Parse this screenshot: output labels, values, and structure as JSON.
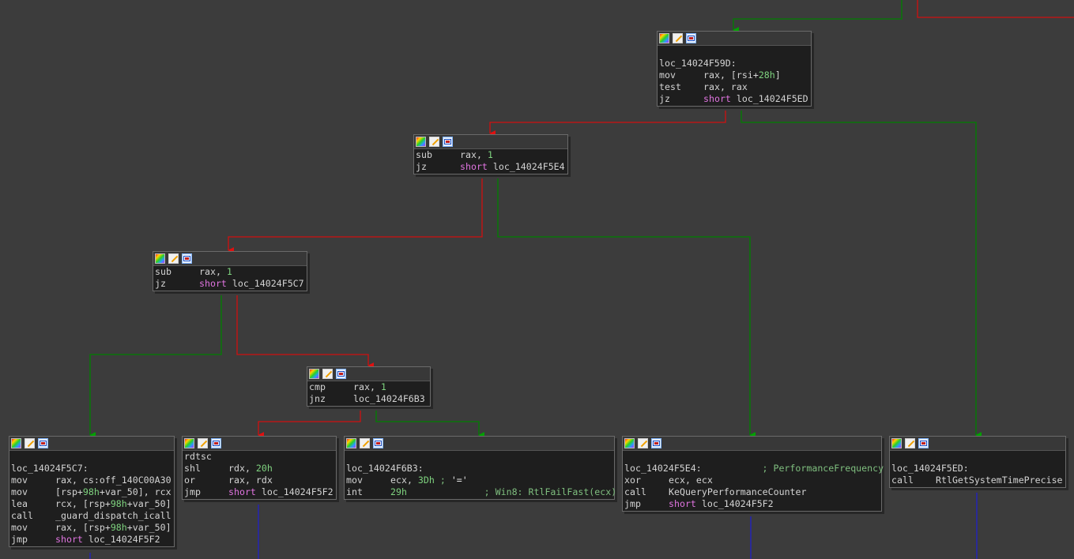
{
  "nodes": {
    "n59d": {
      "label": "loc_14024F59D:",
      "lines": [
        {
          "mn": "mov",
          "op": "rax, [rsi+",
          "num": "28h",
          "rest": "]"
        },
        {
          "mn": "test",
          "op": "rax, rax"
        },
        {
          "mn": "jz",
          "kw": "short",
          "target": "loc_14024F5ED"
        }
      ]
    },
    "n_sub1": {
      "lines": [
        {
          "mn": "sub",
          "op": "rax, ",
          "num": "1"
        },
        {
          "mn": "jz",
          "kw": "short",
          "target": "loc_14024F5E4"
        }
      ]
    },
    "n_sub2": {
      "lines": [
        {
          "mn": "sub",
          "op": "rax, ",
          "num": "1"
        },
        {
          "mn": "jz",
          "kw": "short",
          "target": "loc_14024F5C7"
        }
      ]
    },
    "n_cmp": {
      "lines": [
        {
          "mn": "cmp",
          "op": "rax, ",
          "num": "1"
        },
        {
          "mn": "jnz",
          "target": "loc_14024F6B3"
        }
      ]
    },
    "n5c7": {
      "label": "loc_14024F5C7:",
      "lines": [
        {
          "mn": "mov",
          "op": "rax, cs:off_140C00A30"
        },
        {
          "mn": "mov",
          "op": "[rsp+",
          "num": "98h",
          "rest": "+var_50], rcx"
        },
        {
          "mn": "lea",
          "op": "rcx, [rsp+",
          "num": "98h",
          "rest": "+var_50]"
        },
        {
          "mn": "call",
          "op": "_guard_dispatch_icall"
        },
        {
          "mn": "mov",
          "op": "rax, [rsp+",
          "num": "98h",
          "rest": "+var_50]"
        },
        {
          "mn": "jmp",
          "kw": "short",
          "target": "loc_14024F5F2"
        }
      ]
    },
    "n_rdtsc": {
      "lines": [
        {
          "mn": "rdtsc"
        },
        {
          "mn": "shl",
          "op": "rdx, ",
          "num": "20h"
        },
        {
          "mn": "or",
          "op": "rax, rdx"
        },
        {
          "mn": "jmp",
          "kw": "short",
          "target": "loc_14024F5F2"
        }
      ]
    },
    "n6b3": {
      "label": "loc_14024F6B3:",
      "lines": [
        {
          "mn": "mov",
          "op": "ecx, ",
          "num": "3Dh",
          "cmt": " ; ",
          "str": "'='"
        },
        {
          "mn": "int",
          "num": "29h",
          "cmt": "              ; Win8: RtlFailFast(ecx)"
        }
      ]
    },
    "n5e4": {
      "label": "loc_14024F5E4:",
      "label_cmt": "           ; PerformanceFrequency",
      "lines": [
        {
          "mn": "xor",
          "op": "ecx, ecx"
        },
        {
          "mn": "call",
          "op": "KeQueryPerformanceCounter"
        },
        {
          "mn": "jmp",
          "kw": "short",
          "target": "loc_14024F5F2"
        }
      ]
    },
    "n5ed": {
      "label": "loc_14024F5ED:",
      "lines": [
        {
          "mn": "call",
          "op": "RtlGetSystemTimePrecise"
        }
      ]
    }
  },
  "colors": {
    "background": "#3c3c3c",
    "edge_true": "#008000",
    "edge_false": "#d01010",
    "edge_uncond": "#2020c8",
    "number": "#7fd37f",
    "keyword": "#e074e0",
    "comment": "#7fbf7f"
  },
  "icons": [
    "color-palette-icon",
    "rename-icon",
    "group-nodes-icon"
  ]
}
